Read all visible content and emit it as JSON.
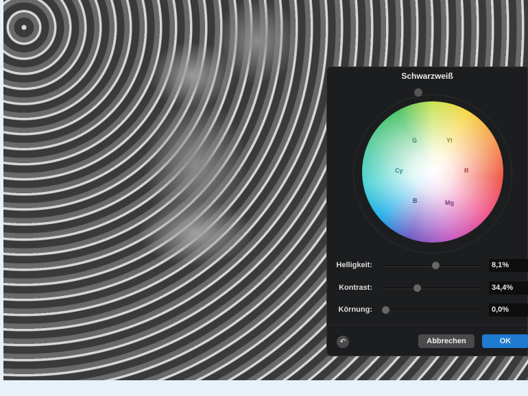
{
  "panel": {
    "title": "Schwarzweiß",
    "wheel_labels": {
      "g": "G",
      "yl": "Yl",
      "cy": "Cy",
      "r": "R",
      "b": "B",
      "mg": "Mg"
    },
    "sliders": [
      {
        "label": "Helligkeit:",
        "value": "8,1%",
        "position": 0.54
      },
      {
        "label": "Kontrast:",
        "value": "34,4%",
        "position": 0.35
      },
      {
        "label": "Körnung:",
        "value": "0,0%",
        "position": 0.0
      }
    ],
    "buttons": {
      "cancel": "Abbrechen",
      "ok": "OK"
    },
    "colors": {
      "ok": "#1e7bd0",
      "panel": "#1c1d1f"
    }
  }
}
